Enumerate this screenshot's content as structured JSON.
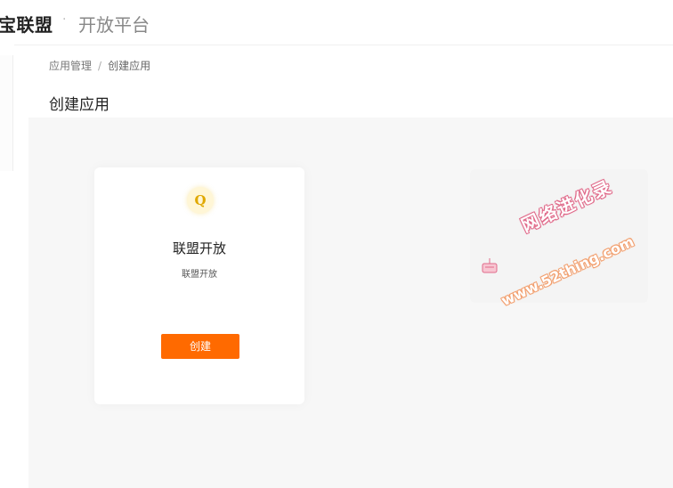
{
  "header": {
    "brand": "宝联盟",
    "separator": "·",
    "subtitle": "开放平台"
  },
  "breadcrumb": {
    "items": [
      "应用管理",
      "创建应用"
    ],
    "separator": "/"
  },
  "page": {
    "title": "创建应用"
  },
  "card": {
    "icon": "Q",
    "title": "联盟开放",
    "description": "联盟开放",
    "button_label": "创建"
  },
  "watermark": {
    "line1": "网络进化录",
    "line2": "www.52thing.com"
  },
  "colors": {
    "accent": "#ff6a00",
    "content_bg": "#f7f7f7",
    "icon_bg": "#fff6d6",
    "icon_fg": "#e0a800"
  }
}
